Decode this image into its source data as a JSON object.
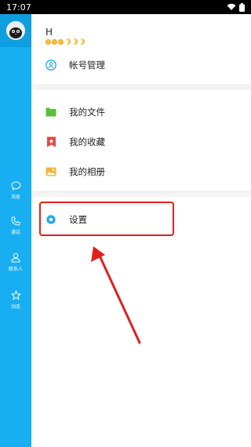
{
  "status_bar": {
    "time": "17:07"
  },
  "rail": {
    "items": [
      {
        "label": "消息",
        "icon": "message-icon"
      },
      {
        "label": "通话",
        "icon": "phone-icon"
      },
      {
        "label": "联系人",
        "icon": "contact-icon"
      },
      {
        "label": "动态",
        "icon": "star-icon"
      }
    ]
  },
  "profile": {
    "name": "H"
  },
  "menu": {
    "account": "帐号管理",
    "files": "我的文件",
    "favorites": "我的收藏",
    "albums": "我的相册",
    "settings": "设置"
  },
  "colors": {
    "rail": "#17aef2",
    "highlight": "#e02020",
    "files_icon": "#5bbf3a",
    "favorites_icon": "#e24747",
    "albums_icon": "#f2b53a",
    "settings_icon": "#1ea7e8"
  }
}
